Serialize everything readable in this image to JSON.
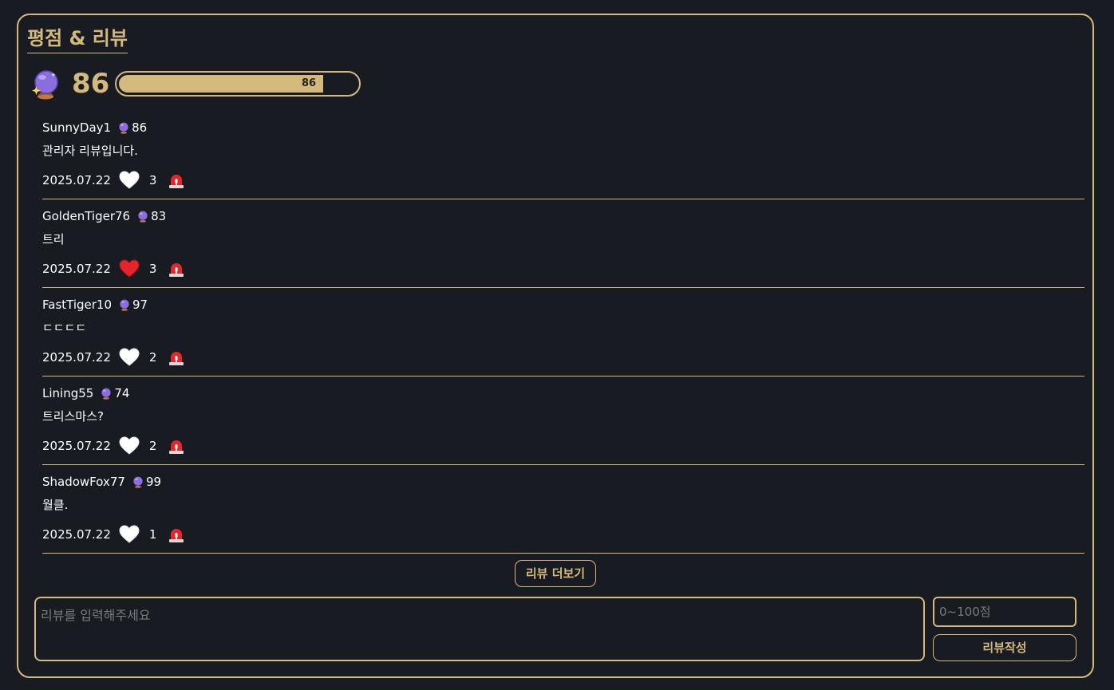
{
  "section": {
    "title": "평점 & 리뷰"
  },
  "rating": {
    "icon": "crystal-ball-icon",
    "score": "86",
    "bar_label": "86",
    "bar_fraction": 0.86,
    "accent": "#d4b97c"
  },
  "reviews": [
    {
      "user": "SunnyDay1",
      "score": "86",
      "text": "관리자 리뷰입니다.",
      "date": "2025.07.22",
      "likes": "3",
      "liked": false
    },
    {
      "user": "GoldenTiger76",
      "score": "83",
      "text": "트리",
      "date": "2025.07.22",
      "likes": "3",
      "liked": true
    },
    {
      "user": "FastTiger10",
      "score": "97",
      "text": "ㄷㄷㄷㄷ",
      "date": "2025.07.22",
      "likes": "2",
      "liked": false
    },
    {
      "user": "Lining55",
      "score": "74",
      "text": "트리스마스?",
      "date": "2025.07.22",
      "likes": "2",
      "liked": false
    },
    {
      "user": "ShadowFox77",
      "score": "99",
      "text": "월클.",
      "date": "2025.07.22",
      "likes": "1",
      "liked": false
    }
  ],
  "more_button": "리뷰 더보기",
  "form": {
    "review_placeholder": "리뷰를 입력해주세요",
    "score_placeholder": "0~100점",
    "submit_label": "리뷰작성"
  }
}
